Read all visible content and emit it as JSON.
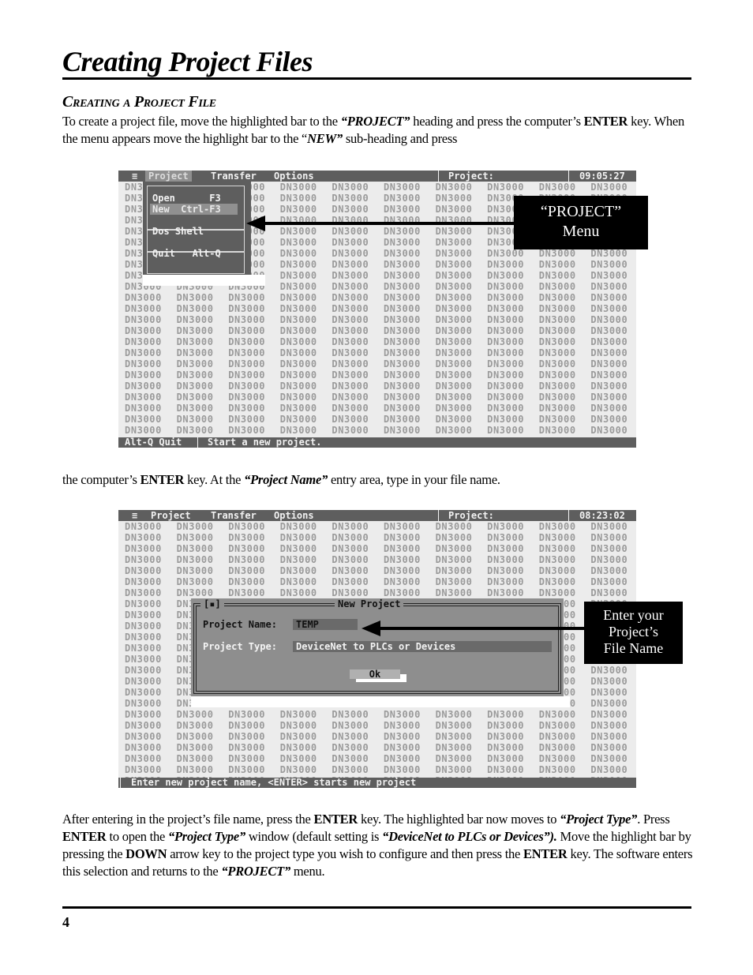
{
  "page": {
    "title": "Creating Project Files",
    "section_heading": "Creating a Project File",
    "page_number": "4"
  },
  "paragraphs": {
    "p1": [
      {
        "t": "To create a project file, move the highlighted bar to the ",
        "s": ""
      },
      {
        "t": "“PROJECT”",
        "s": "bi"
      },
      {
        "t": " heading and press the computer’s ",
        "s": ""
      },
      {
        "t": "ENTER",
        "s": "b"
      },
      {
        "t": " key.  When the menu appears move the highlight bar to the “",
        "s": ""
      },
      {
        "t": "NEW”",
        "s": "bi"
      },
      {
        "t": " sub-heading and press",
        "s": ""
      }
    ],
    "p2": [
      {
        "t": "the computer’s ",
        "s": ""
      },
      {
        "t": "ENTER",
        "s": "b"
      },
      {
        "t": " key.  At the ",
        "s": ""
      },
      {
        "t": "“Project Name”",
        "s": "bi"
      },
      {
        "t": " entry area, type in your file name.",
        "s": ""
      }
    ],
    "p3": [
      {
        "t": "After entering in the project’s file name, press the ",
        "s": ""
      },
      {
        "t": "ENTER",
        "s": "b"
      },
      {
        "t": " key.  The highlighted bar now moves to ",
        "s": ""
      },
      {
        "t": "“Project Type”",
        "s": "bi"
      },
      {
        "t": ".  Press ",
        "s": ""
      },
      {
        "t": "ENTER",
        "s": "b"
      },
      {
        "t": " to open the ",
        "s": ""
      },
      {
        "t": "“Project Type”",
        "s": "bi"
      },
      {
        "t": " window (default setting is ",
        "s": ""
      },
      {
        "t": "“DeviceNet to PLCs or Devices”).",
        "s": "bi"
      },
      {
        "t": "  Move the highlight bar by pressing the ",
        "s": ""
      },
      {
        "t": "DOWN",
        "s": "b"
      },
      {
        "t": " arrow key  to the project type you wish to configure and then press the ",
        "s": ""
      },
      {
        "t": "ENTER",
        "s": "b"
      },
      {
        "t": " key.  The software enters this selection and returns to the ",
        "s": ""
      },
      {
        "t": "“PROJECT”",
        "s": "bi"
      },
      {
        "t": " menu.",
        "s": ""
      }
    ]
  },
  "screen1": {
    "menu_icon": "≡",
    "menus": [
      "Project",
      "Transfer",
      "Options"
    ],
    "active_menu": "Project",
    "project_label": "Project:",
    "clock": "09:05:27",
    "grid_cell": "DN3000",
    "dropdown_items": [
      {
        "label": "Open      F3",
        "highlighted": false
      },
      {
        "label": "New  Ctrl-F3",
        "highlighted": true
      },
      {
        "label": "Dos Shell",
        "highlighted": false
      },
      {
        "label": "Quit   Alt-Q",
        "highlighted": false
      }
    ],
    "status_left": "Alt-Q Quit",
    "status_right": "Start a new project.",
    "callout_line1": "“PROJECT”",
    "callout_line2": "Menu"
  },
  "screen2": {
    "menu_icon": "≡",
    "menus": [
      "Project",
      "Transfer",
      "Options"
    ],
    "project_label": "Project:",
    "clock": "08:23:02",
    "grid_cell": "DN3000",
    "dialog": {
      "close_box": "[▪]",
      "title": "New Project",
      "name_label": "Project Name:",
      "name_value": "TEMP",
      "type_label": "Project Type:",
      "type_value": "DeviceNet to PLCs or Devices",
      "ok_label": "Ok"
    },
    "status": "Enter new project name, <ENTER> starts new project",
    "callout_lines": [
      "Enter your",
      "Project’s",
      "File Name"
    ]
  }
}
